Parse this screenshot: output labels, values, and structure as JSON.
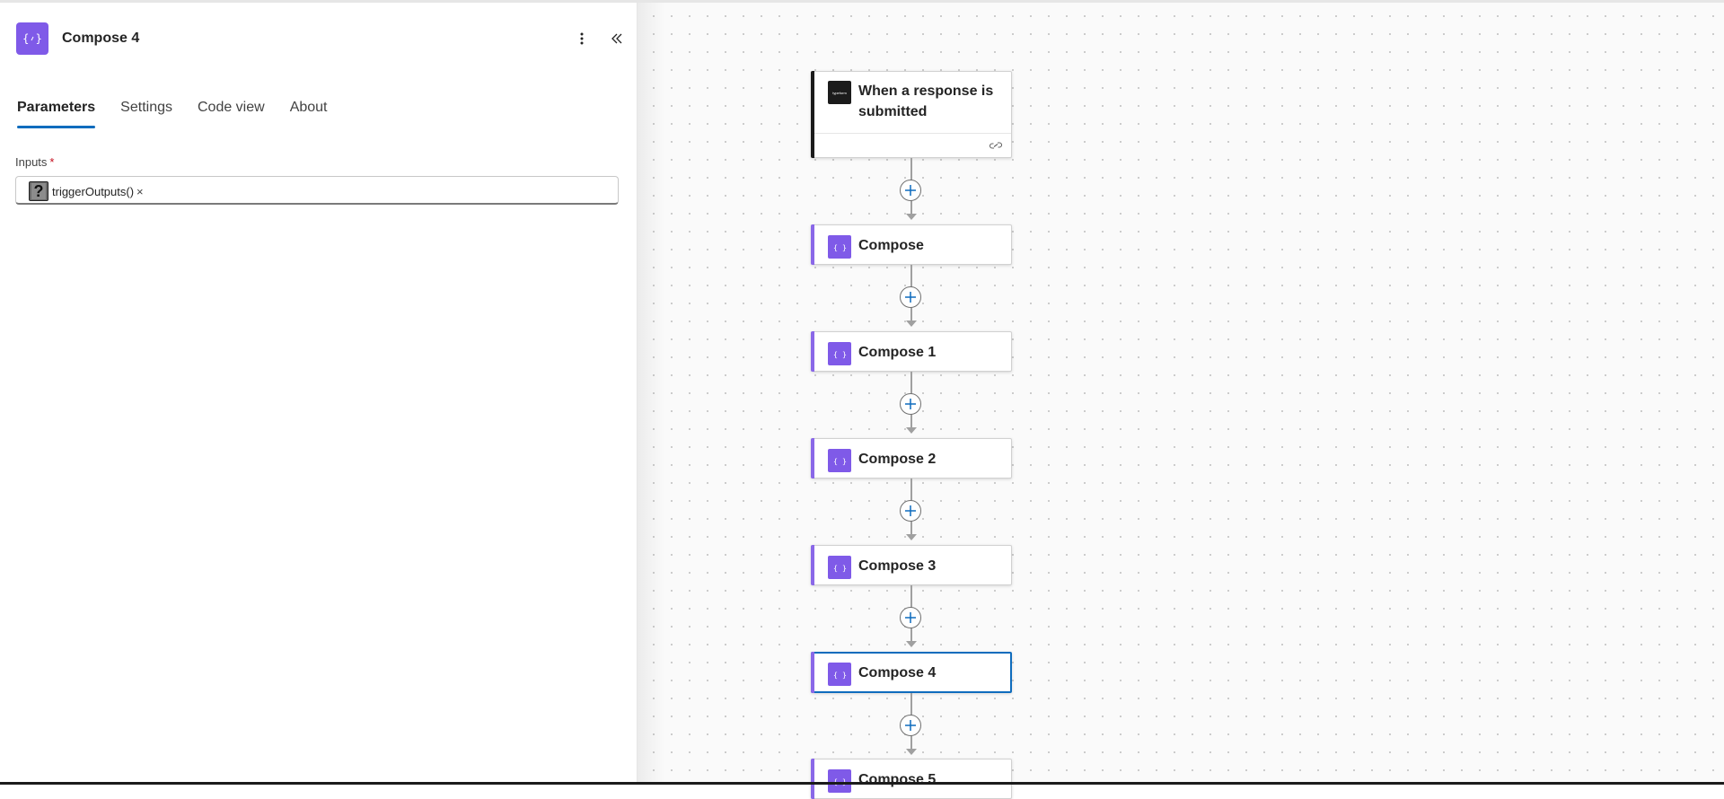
{
  "panel": {
    "title": "Compose 4",
    "tabs": [
      {
        "label": "Parameters",
        "active": true
      },
      {
        "label": "Settings",
        "active": false
      },
      {
        "label": "Code view",
        "active": false
      },
      {
        "label": "About",
        "active": false
      }
    ],
    "inputs_label": "Inputs",
    "required_mark": "*",
    "token": {
      "icon_glyph": "?",
      "text": "triggerOutputs()",
      "remove": "×"
    }
  },
  "flow": {
    "trigger": {
      "label": "When a response is submitted",
      "icon_text": "typeform"
    },
    "nodes": [
      {
        "label": "Compose"
      },
      {
        "label": "Compose 1"
      },
      {
        "label": "Compose 2"
      },
      {
        "label": "Compose 3"
      },
      {
        "label": "Compose 4",
        "selected": true
      },
      {
        "label": "Compose 5"
      }
    ]
  },
  "colors": {
    "accent_purple": "#7f5ae8",
    "selection_blue": "#0f6cbd",
    "required_red": "#c50f1f"
  },
  "icons": [
    "compose-icon",
    "more-vertical-icon",
    "collapse-double-chevron-icon",
    "help-token-icon",
    "link-icon",
    "add-step-icon"
  ]
}
